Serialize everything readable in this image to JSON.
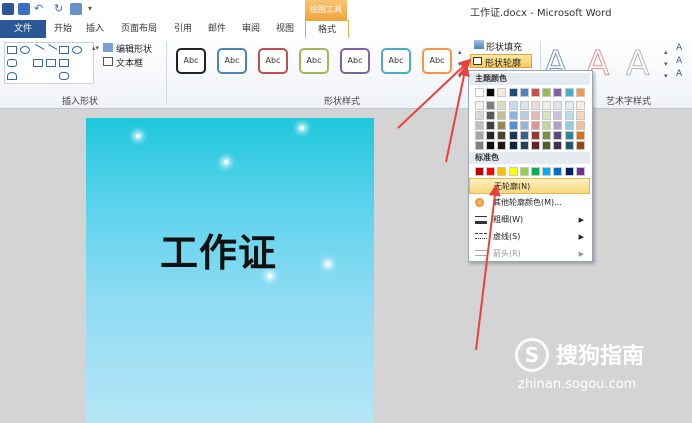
{
  "window": {
    "doc_title": "工作证.docx - Microsoft Word",
    "context_tools": "绘图工具"
  },
  "tabs": [
    "文件",
    "开始",
    "插入",
    "页面布局",
    "引用",
    "邮件",
    "审阅",
    "视图",
    "格式"
  ],
  "ribbon": {
    "insert_shapes": {
      "group_label": "插入形状",
      "edit_shape": "编辑形状",
      "text_box": "文本框"
    },
    "shape_styles": {
      "group_label": "形状样式",
      "style_label": "Abc",
      "style_colors": [
        "#222222",
        "#4f81bd",
        "#c0504d",
        "#9bbb59",
        "#8064a2",
        "#4bacc6",
        "#f79646"
      ],
      "fill": "形状填充",
      "outline": "形状轮廓"
    },
    "wordart_styles": {
      "group_label": "艺术字样式",
      "glyph": "A"
    }
  },
  "document": {
    "page_title": "工作证"
  },
  "dropdown": {
    "theme_colors_label": "主题颜色",
    "standard_colors_label": "标准色",
    "no_outline": "无轮廓(N)",
    "more_colors": "其他轮廓颜色(M)...",
    "weight": "粗细(W)",
    "dashes": "虚线(S)",
    "arrows": "箭头(R)",
    "theme_top": [
      "#ffffff",
      "#000000",
      "#eeece1",
      "#1f497d",
      "#4f81bd",
      "#c0504d",
      "#9bbb59",
      "#8064a2",
      "#4bacc6",
      "#f79646"
    ],
    "theme_shades": [
      [
        "#f2f2f2",
        "#7f7f7f",
        "#ddd9c3",
        "#c6d9f0",
        "#dbe5f1",
        "#f2dcdb",
        "#ebf1dd",
        "#e5e0ec",
        "#dbeef3",
        "#fdeada"
      ],
      [
        "#d8d8d8",
        "#595959",
        "#c4bd97",
        "#8db3e2",
        "#b8cce4",
        "#e5b9b7",
        "#d7e3bc",
        "#ccc1d9",
        "#b7dde8",
        "#fbd5b5"
      ],
      [
        "#bfbfbf",
        "#3f3f3f",
        "#938953",
        "#548dd4",
        "#95b3d7",
        "#d99694",
        "#c3d69b",
        "#b2a2c7",
        "#92cddc",
        "#fac08f"
      ],
      [
        "#a5a5a5",
        "#262626",
        "#494429",
        "#17365d",
        "#366092",
        "#953734",
        "#76923c",
        "#5f497a",
        "#31859b",
        "#e36c09"
      ],
      [
        "#7f7f7f",
        "#0c0c0c",
        "#1d1b10",
        "#0f243e",
        "#244061",
        "#632423",
        "#4f6128",
        "#3f3151",
        "#205867",
        "#974806"
      ]
    ],
    "standard": [
      "#c00000",
      "#ff0000",
      "#ffc000",
      "#ffff00",
      "#92d050",
      "#00b050",
      "#00b0f0",
      "#0070c0",
      "#002060",
      "#7030a0"
    ]
  },
  "watermark": {
    "logo_glyph": "S",
    "name": "搜狗指南",
    "url": "zhinan.sogou.com"
  },
  "annotation_color": "#e8423a"
}
